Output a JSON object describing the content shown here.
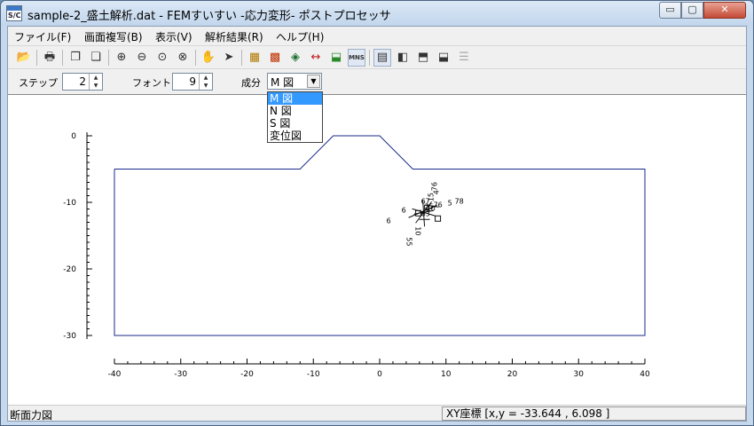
{
  "window": {
    "title": "sample-2_盛土解析.dat - FEMすいすい -応力変形- ポストプロセッサ",
    "icon_text": "S/C"
  },
  "window_buttons": {
    "minimize": "▭",
    "maximize": "▢",
    "close": "✕"
  },
  "menu": [
    {
      "label": "ファイル(F)"
    },
    {
      "label": "画面複写(B)"
    },
    {
      "label": "表示(V)"
    },
    {
      "label": "解析結果(R)"
    },
    {
      "label": "ヘルプ(H)"
    }
  ],
  "toolbar": [
    {
      "icon": "open-icon",
      "glyph": "📂"
    },
    {
      "icon": "print-icon",
      "glyph": "🖶"
    },
    {
      "icon": "copy-icon",
      "glyph": "❐"
    },
    {
      "icon": "paste-icon",
      "glyph": "❏"
    },
    {
      "icon": "zoom-in-icon",
      "glyph": "⊕"
    },
    {
      "icon": "zoom-out-icon",
      "glyph": "⊖"
    },
    {
      "icon": "zoom-fit-icon",
      "glyph": "⊙"
    },
    {
      "icon": "zoom-window-icon",
      "glyph": "⊗"
    },
    {
      "icon": "hand-pan-icon",
      "glyph": "✋"
    },
    {
      "icon": "pointer-icon",
      "glyph": "➤"
    },
    {
      "icon": "mesh-icon",
      "glyph": "▦"
    },
    {
      "icon": "mesh-nodes-icon",
      "glyph": "▩"
    },
    {
      "icon": "material-icon",
      "glyph": "◈"
    },
    {
      "icon": "dimension-icon",
      "glyph": "↔"
    },
    {
      "icon": "load-icon",
      "glyph": "⬓"
    },
    {
      "icon": "mns-icon",
      "glyph": "MNS"
    },
    {
      "icon": "view-num-icon",
      "glyph": "▤"
    },
    {
      "icon": "view-left-icon",
      "glyph": "◧"
    },
    {
      "icon": "view-bottom-icon",
      "glyph": "⬒"
    },
    {
      "icon": "view-top-icon",
      "glyph": "⬓"
    },
    {
      "icon": "list-icon",
      "glyph": "☰"
    }
  ],
  "options": {
    "step_label": "ステップ",
    "step_value": "2",
    "font_label": "フォント",
    "font_value": "9",
    "component_label": "成分",
    "component_value": "M 図"
  },
  "dropdown": [
    "M 図",
    "N 図",
    "S 図",
    "変位図"
  ],
  "chart_data": {
    "type": "line",
    "title": "",
    "xlabel": "",
    "ylabel": "",
    "xlim": [
      -40,
      40
    ],
    "ylim": [
      -30,
      0
    ],
    "x_ticks": [
      -40,
      -30,
      -20,
      -10,
      0,
      10,
      20,
      30,
      40
    ],
    "y_ticks": [
      0,
      -10,
      -20,
      -30
    ],
    "grid": false,
    "series": [
      {
        "values": [
          [
            -40,
            -5
          ],
          [
            -12,
            -5
          ],
          [
            -7,
            0
          ],
          [
            0,
            0
          ],
          [
            5,
            -5
          ],
          [
            40,
            -5
          ],
          [
            40,
            -30
          ],
          [
            -40,
            -30
          ],
          [
            -40,
            -5
          ]
        ]
      }
    ],
    "annotations": [
      "76",
      "78",
      "5",
      "15",
      "4",
      "6",
      "9",
      "10",
      "25",
      "63",
      "55",
      "67",
      "10",
      "76"
    ]
  },
  "status": {
    "left": "断面力図",
    "right": "XY座標 [x,y  =   -33.644 , 6.098 ]"
  },
  "colors": {
    "model_line": "#1a2a8a",
    "axis": "#000000",
    "title_bg": "#c6d8ec",
    "selection": "#3399ff"
  }
}
